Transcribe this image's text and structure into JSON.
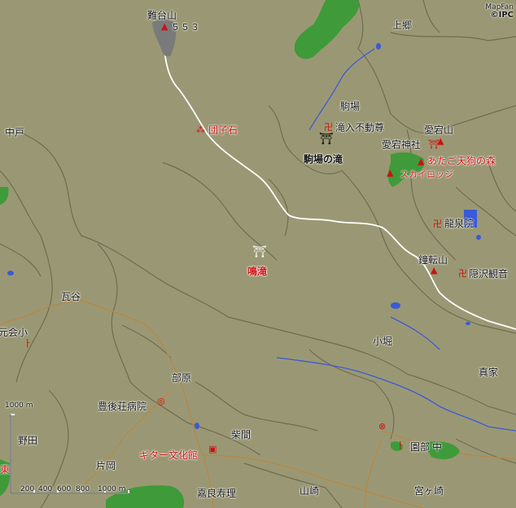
{
  "credit": {
    "provider": "MapFan",
    "copyright": "©IPC"
  },
  "labels": {
    "nantaisan": "難台山",
    "nantaisan_elev": "５５３",
    "kamigo": "上郷",
    "nakado": "中戸",
    "dangoishi": "団子石",
    "komaba": "駒場",
    "takiiri_fudoson": "滝入不動尊",
    "atagoyama": "愛宕山",
    "atago_jinja": "愛宕神社",
    "atago_tengu": "あたご天狗の森",
    "skylodge": "スカイロッジ",
    "komaba_falls": "駒場の滝",
    "ryusenin": "龍泉院",
    "narutaki": "鳴滝",
    "shotenzan": "鐘転山",
    "inzawa_kannon": "隠沢観音",
    "kawaya": "瓦谷",
    "kyokaisho": "元会小",
    "kobori": "小堀",
    "makabe": "真家",
    "hebara": "部原",
    "bungoso_hospital": "豊後荘病院",
    "shibama": "柴間",
    "noda": "野田",
    "guitar_museum": "ギター文化館",
    "kataoka": "片岡",
    "sonobe": "園部",
    "sonobe_naka": "中",
    "tou_partial": "東",
    "yoshirasuhara": "嘉良寿理",
    "yamazaki": "山崎",
    "miyazaki": "宮ヶ崎"
  },
  "scale": {
    "top_label": "1000 m",
    "ticks": [
      "200",
      "400",
      "600",
      "800",
      "1000 m"
    ]
  },
  "colors": {
    "land": "#9a9874",
    "boundary": "#6e6c52",
    "road": "#ffffff",
    "road_minor": "#b5894a",
    "river": "#3a5ad8",
    "forest": "#3f9a3a",
    "summit": "#7a7a7a",
    "poi_red": "#cc1111"
  },
  "icons": {
    "summit": "triangle-icon",
    "temple": "manji-icon",
    "shrine": "torii-icon",
    "waterfall": "waterfall-icon",
    "hospital": "hospital-icon",
    "museum": "museum-icon",
    "school": "school-icon",
    "post": "post-office-icon",
    "rock": "rock-icon",
    "lodge": "lodge-icon"
  }
}
